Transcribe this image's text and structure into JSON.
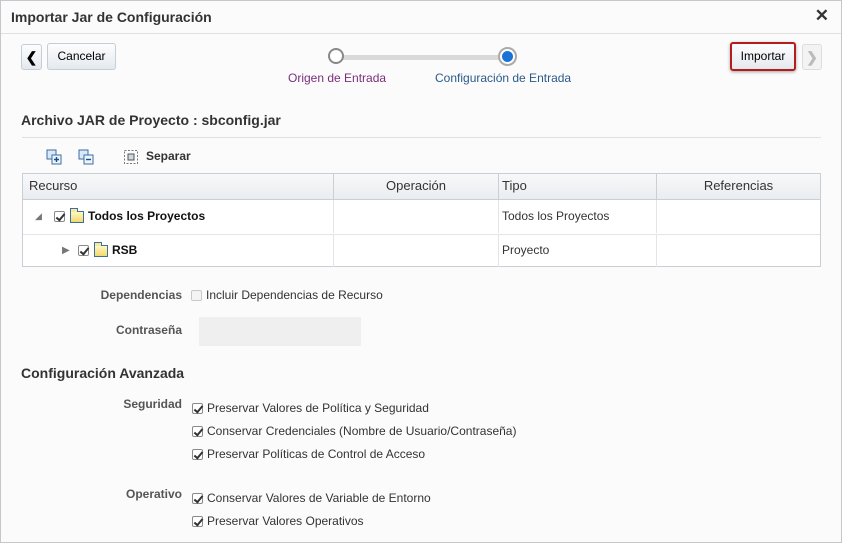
{
  "dialog": {
    "title": "Importar Jar de Configuración",
    "close_glyph": "✕"
  },
  "nav": {
    "back_glyph": "❮",
    "cancel_label": "Cancelar",
    "import_label": "Importar",
    "next_glyph": "❯"
  },
  "train": {
    "steps": [
      {
        "label": "Origen de Entrada",
        "state": "visited"
      },
      {
        "label": "Configuración de Entrada",
        "state": "current"
      }
    ]
  },
  "archivo": {
    "title": "Archivo JAR de Proyecto : sbconfig.jar",
    "toolbar": {
      "expand_icon": "expand-all-icon",
      "collapse_icon": "collapse-all-icon",
      "separar_icon": "detach-icon",
      "separar_label": "Separar"
    },
    "columns": [
      "Recurso",
      "Operación",
      "Tipo",
      "Referencias"
    ],
    "rows": [
      {
        "name": "Todos los Proyectos",
        "operacion": "",
        "tipo": "Todos los Proyectos",
        "referencias": "",
        "checked": true,
        "expanded": true
      },
      {
        "name": "RSB",
        "operacion": "",
        "tipo": "Proyecto",
        "referencias": "",
        "checked": true,
        "expanded": false
      }
    ]
  },
  "form": {
    "dependencias_label": "Dependencias",
    "dependencias_option": "Incluir Dependencias de Recurso",
    "contrasena_label": "Contraseña",
    "contrasena_value": ""
  },
  "avanzada": {
    "title": "Configuración Avanzada",
    "seguridad_label": "Seguridad",
    "seguridad_options": [
      "Preservar Valores de Política y Seguridad",
      "Conservar Credenciales (Nombre de Usuario/Contraseña)",
      "Preservar Políticas de Control de Acceso"
    ],
    "operativo_label": "Operativo",
    "operativo_options": [
      "Conservar Valores de Variable de Entorno",
      "Preservar Valores Operativos"
    ]
  },
  "colors": {
    "accent": "#1a73d4",
    "import_border": "#b31d1d",
    "visited_step": "#7a2e7a",
    "current_step": "#2a5a8a"
  }
}
